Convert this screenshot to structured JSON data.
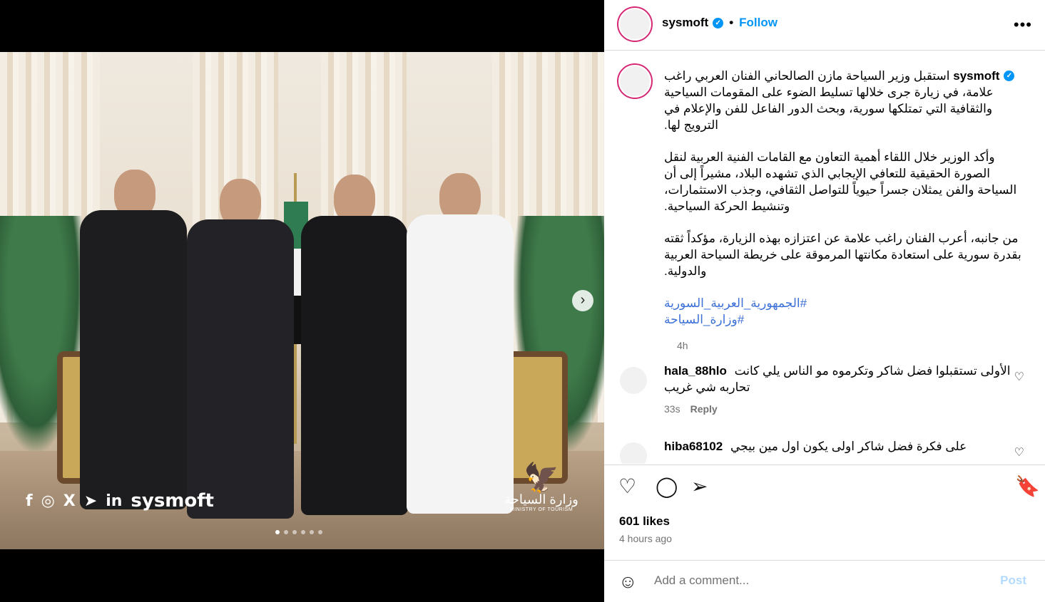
{
  "post": {
    "username": "sysmoft",
    "follow_label": "Follow",
    "more_label": "•••",
    "caption": {
      "paragraphs": [
        "استقبل وزير السياحة مازن الصالحاني الفنان العربي راغب علامة، في زيارة جرى خلالها تسليط الضوء على المقومات السياحية والثقافية التي تمتلكها سورية، وبحث الدور الفاعل للفن والإعلام في الترويج لها.",
        "وأكد الوزير خلال اللقاء أهمية التعاون مع القامات الفنية العربية لنقل الصورة الحقيقية للتعافي الإيجابي الذي تشهده البلاد، مشيراً إلى أن السياحة والفن يمثلان جسراً حيوياً للتواصل الثقافي، وجذب الاستثمارات، وتنشيط الحركة السياحية.",
        "من جانبه، أعرب الفنان راغب علامة عن اعتزازه بهذه الزيارة، مؤكداً ثقته بقدرة سورية على استعادة مكانتها المرموقة على خريطة السياحة العربية والدولية."
      ],
      "hashtags": [
        "#الجمهورية_العربية_السورية",
        "#وزارة_السياحة"
      ],
      "time": "4h"
    },
    "comments": [
      {
        "user": "hala_88hlo",
        "text": "الأولى تستقبلوا فضل شاكر وتكرموه مو الناس يلي كانت تحاربه شي غريب",
        "time": "33s",
        "reply": "Reply"
      },
      {
        "user": "hiba68102",
        "text": "على فكرة فضل شاكر اولى يكون اول مين بيجي",
        "time": "",
        "reply": ""
      }
    ],
    "likes": "601 likes",
    "posted_ago": "4 hours ago",
    "add_comment_placeholder": "Add a comment...",
    "post_label": "Post"
  },
  "media": {
    "brand_text": "sysmoft",
    "ministry_ar": "وزارة السياحة",
    "ministry_en": "MINISTRY OF TOURISM",
    "carousel_index": 1,
    "carousel_count": 6
  },
  "icons": {
    "heart": "heart-icon",
    "comment": "comment-icon",
    "share": "share-icon",
    "save": "bookmark-icon",
    "emoji": "emoji-icon"
  },
  "colors": {
    "accent": "#0095f6",
    "hashtag": "#3c70d6",
    "muted": "#737373"
  }
}
